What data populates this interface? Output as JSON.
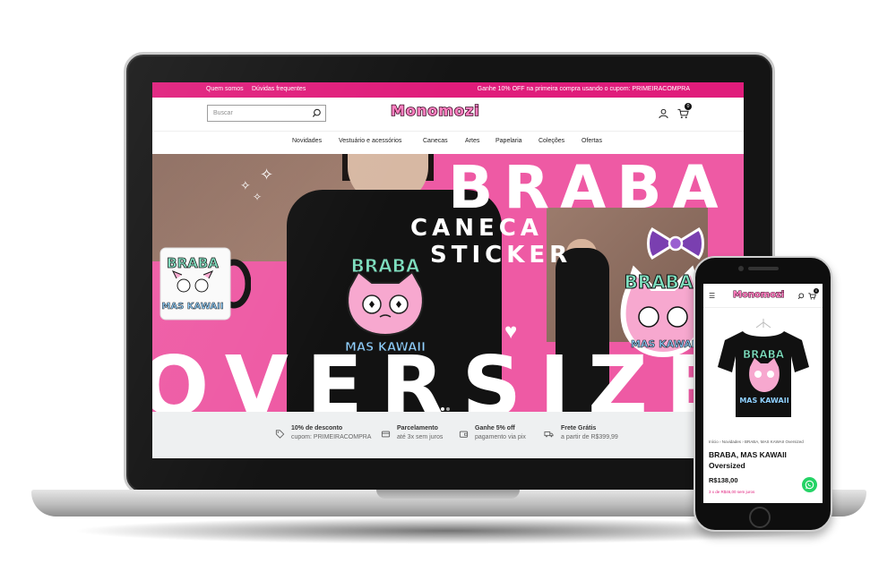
{
  "promo": {
    "link_about": "Quem somos",
    "link_faq": "Dúvidas frequentes",
    "message": "Ganhe 10% OFF na primeira compra usando o cupom: PRIMEIRACOMPRA"
  },
  "header": {
    "search_placeholder": "Buscar",
    "logo": "Monomozi",
    "cart_count": "0"
  },
  "nav": {
    "items": [
      "Novidades",
      "Vestuário e acessórios",
      "Canecas",
      "Artes",
      "Papelaria",
      "Coleções",
      "Ofertas"
    ]
  },
  "hero": {
    "headline": "BRABA",
    "line1": "CANECA",
    "line2": "STICKER",
    "big": "OVERSIZE",
    "shirt_text_top": "BRABA",
    "shirt_text_bottom": "MAS KAWAII"
  },
  "benefits": [
    {
      "icon": "tag-icon",
      "title": "10% de desconto",
      "subtitle": "cupom: PRIMEIRACOMPRA"
    },
    {
      "icon": "card-icon",
      "title": "Parcelamento",
      "subtitle": "até 3x sem juros"
    },
    {
      "icon": "wallet-icon",
      "title": "Ganhe 5% off",
      "subtitle": "pagamento via pix"
    },
    {
      "icon": "truck-icon",
      "title": "Frete Grátis",
      "subtitle": "a partir de R$399,99"
    }
  ],
  "mobile": {
    "logo": "Monomozi",
    "cart_count": "0",
    "breadcrumb": "Início  ›  Novidades  ›  BRABA, MAS KAWAII Oversized",
    "product_title": "BRABA, MAS KAWAII Oversized",
    "price": "R$138,00",
    "installments": "3 x de R$46,00 sem juros"
  },
  "colors": {
    "brand_pink": "#e01c7b",
    "hero_pink": "#ee5aa4",
    "whatsapp": "#25d366"
  }
}
